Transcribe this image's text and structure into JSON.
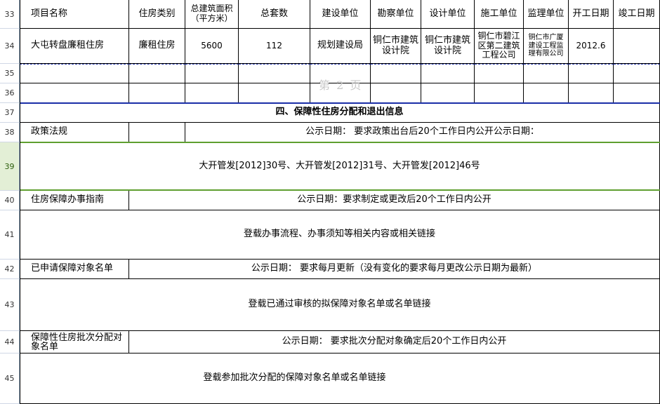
{
  "rows": {
    "r33": "33",
    "r34": "34",
    "r35": "35",
    "r36": "36",
    "r37": "37",
    "r38": "38",
    "r39": "39",
    "r40": "40",
    "r41": "41",
    "r42": "42",
    "r43": "43",
    "r44": "44",
    "r45": "45"
  },
  "header": {
    "project_name": "项目名称",
    "housing_type": "住房类别",
    "total_area": "总建筑面积（平方米）",
    "total_units": "总套数",
    "developer": "建设单位",
    "survey_unit": "勘察单位",
    "design_unit": "设计单位",
    "construction_unit": "施工单位",
    "supervision_unit": "监理单位",
    "start_date": "开工日期",
    "completion_date": "竣工日期"
  },
  "project": {
    "name": "大屯转盘廉租住房",
    "type": "廉租住房",
    "area": "5600",
    "units": "112",
    "developer": "规划建设局",
    "survey": "铜仁市建筑设计院",
    "design": "铜仁市建筑设计院",
    "construction": "铜仁市碧江区第二建筑工程公司",
    "supervision": "铜仁市广厦建设工程监理有限公司",
    "start_date": "2012.6"
  },
  "watermark": "第 2 页",
  "section4_title": "四、保障性住房分配和退出信息",
  "policy": {
    "label": "政策法规",
    "notice": "公示日期：  要求政策出台后20个工作日内公开公示日期：",
    "content": "大开管发[2012]30号、大开管发[2012]31号、大开管发[2012]46号"
  },
  "guide": {
    "label": "住房保障办事指南",
    "notice": "公示日期：要求制定或更改后20个工作日内公开",
    "content": "登载办事流程、办事须知等相关内容或相关链接"
  },
  "applicants": {
    "label": "已申请保障对象名单",
    "notice": "公示日期：  要求每月更新（没有变化的要求每月更改公示日期为最新）",
    "content": "登载已通过审核的拟保障对象名单或名单链接"
  },
  "batch": {
    "label": "保障性住房批次分配对象名单",
    "notice": "公示日期：  要求批次分配对象确定后20个工作日内公开",
    "content": "登载参加批次分配的保障对象名单或名单链接"
  }
}
